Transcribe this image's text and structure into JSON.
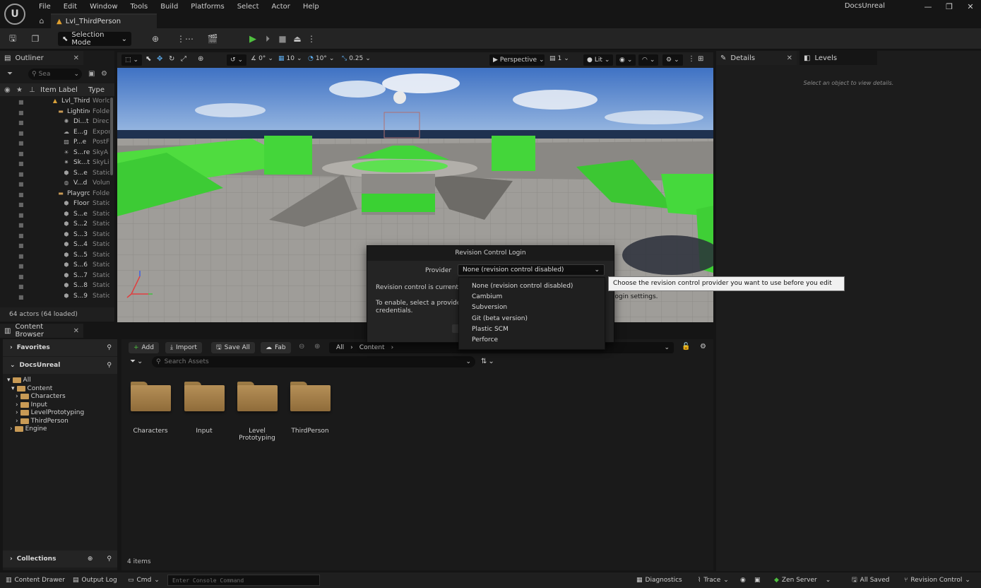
{
  "titlebar": {
    "menu": [
      "File",
      "Edit",
      "Window",
      "Tools",
      "Build",
      "Platforms",
      "Select",
      "Actor",
      "Help"
    ],
    "app_name": "DocsUnreal",
    "level_tab": "Lvl_ThirdPerson"
  },
  "toolbar": {
    "mode_label": "Selection Mode"
  },
  "outliner": {
    "tab": "Outliner",
    "search_placeholder": "Sea",
    "col_label": "Item Label",
    "col_type": "Type",
    "rows": [
      {
        "label": "Lvl_Third",
        "type": "World"
      },
      {
        "label": "Lightinc",
        "type": "Folde"
      },
      {
        "label": "Di...t",
        "type": "Direc"
      },
      {
        "label": "E...g",
        "type": "Expor"
      },
      {
        "label": "P...e",
        "type": "PostF"
      },
      {
        "label": "S...re",
        "type": "SkyA"
      },
      {
        "label": "Sk...t",
        "type": "SkyLi"
      },
      {
        "label": "S...e",
        "type": "Static"
      },
      {
        "label": "V...d",
        "type": "Volun"
      },
      {
        "label": "Playgrc",
        "type": "Folde"
      },
      {
        "label": "Floor",
        "type": "Static"
      },
      {
        "label": "S...e",
        "type": "Static"
      },
      {
        "label": "S...2",
        "type": "Static"
      },
      {
        "label": "S...3",
        "type": "Static"
      },
      {
        "label": "S...4",
        "type": "Static"
      },
      {
        "label": "S...5",
        "type": "Static"
      },
      {
        "label": "S...6",
        "type": "Static"
      },
      {
        "label": "S...7",
        "type": "Static"
      },
      {
        "label": "S...8",
        "type": "Static"
      },
      {
        "label": "S...9",
        "type": "Static"
      }
    ],
    "footer": "64 actors (64 loaded)"
  },
  "viewport_toolbar": {
    "rot_snap": "0°",
    "grid_snap": "10",
    "angle_snap": "10°",
    "scale_snap": "0.25",
    "view": "Perspective",
    "speed": "1",
    "lighting": "Lit"
  },
  "details": {
    "tab": "Details",
    "levels_tab": "Levels",
    "hint": "Select an object to view details."
  },
  "content_browser": {
    "tab": "Content Browser",
    "favorites": "Favorites",
    "project": "DocsUnreal",
    "collections": "Collections",
    "tree": [
      "All",
      "Content",
      "Characters",
      "Input",
      "LevelPrototyping",
      "ThirdPerson",
      "Engine"
    ],
    "buttons": {
      "add": "Add",
      "import": "Import",
      "save_all": "Save All",
      "fab": "Fab"
    },
    "path": [
      "All",
      "Content"
    ],
    "search_placeholder": "Search Assets",
    "assets": [
      {
        "name": "Characters"
      },
      {
        "name": "Input"
      },
      {
        "name": "Level\nPrototyping"
      },
      {
        "name": "ThirdPerson"
      }
    ],
    "count": "4 items"
  },
  "statusbar": {
    "content_drawer": "Content Drawer",
    "output_log": "Output Log",
    "cmd": "Cmd",
    "console_placeholder": "Enter Console Command",
    "diagnostics": "Diagnostics",
    "trace": "Trace",
    "zen": "Zen Server",
    "saved": "All Saved",
    "revision": "Revision Control"
  },
  "dialog": {
    "title": "Revision Control Login",
    "provider_label": "Provider",
    "provider_value": "None  (revision control disabled)",
    "text1": "Revision control is currently",
    "text2a": "To enable, select a provider",
    "text2b": "credentials.",
    "options": [
      "None  (revision control disabled)",
      "Cambium",
      "Subversion",
      "Git  (beta version)",
      "Plastic SCM",
      "Perforce"
    ],
    "tooltip": "Choose the revision control provider you want to use before you edit login settings."
  }
}
